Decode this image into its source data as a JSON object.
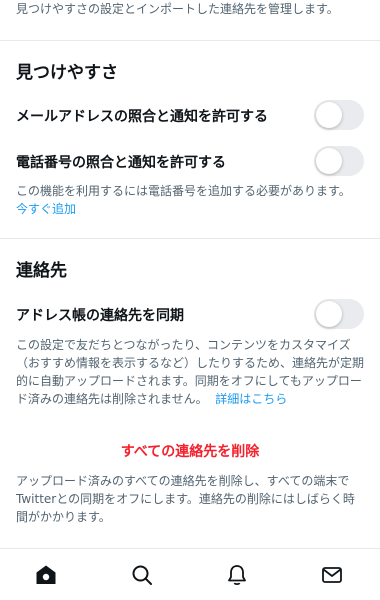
{
  "intro_text": "見つけやすさの設定とインポートした連絡先を管理します。",
  "discoverability": {
    "title": "見つけやすさ",
    "email_label": "メールアドレスの照合と通知を許可する",
    "email_enabled": false,
    "phone_label": "電話番号の照合と通知を許可する",
    "phone_enabled": false,
    "phone_help": "この機能を利用するには電話番号を追加する必要があります。",
    "add_now_link": "今すぐ追加"
  },
  "contacts": {
    "title": "連絡先",
    "sync_label": "アドレス帳の連絡先を同期",
    "sync_enabled": false,
    "sync_help": "この設定で友だちとつながったり、コンテンツをカスタマイズ（おすすめ情報を表示するなど）したりするため、連絡先が定期的に自動アップロードされます。同期をオフにしてもアップロード済みの連絡先は削除されません。",
    "learn_more_link": "詳細はこちら",
    "delete_all_label": "すべての連絡先を削除",
    "delete_help": "アップロード済みのすべての連絡先を削除し、すべての端末でTwitterとの同期をオフにします。連絡先の削除にはしばらく時間がかかります。"
  },
  "tabbar": {
    "items": [
      {
        "icon": "home-icon",
        "active": true
      },
      {
        "icon": "search-icon",
        "active": false
      },
      {
        "icon": "notifications-icon",
        "active": false
      },
      {
        "icon": "messages-icon",
        "active": false
      }
    ]
  },
  "colors": {
    "accent_link": "#1d9bf0",
    "danger": "#f4212e",
    "secondary_text": "#536471",
    "toggle_off": "#e9ebee"
  }
}
